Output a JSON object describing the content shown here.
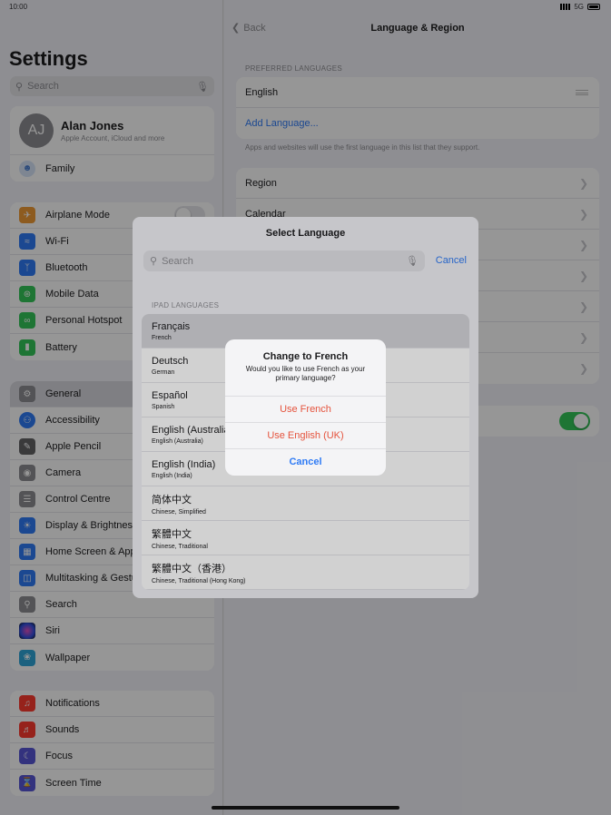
{
  "status": {
    "time": "10:00",
    "network": "5G"
  },
  "sidebar": {
    "title": "Settings",
    "search_placeholder": "Search",
    "profile": {
      "initials": "AJ",
      "name": "Alan Jones",
      "subtitle": "Apple Account, iCloud and more",
      "family": "Family"
    },
    "group1": [
      "Airplane Mode",
      "Wi-Fi",
      "Bluetooth",
      "Mobile Data",
      "Personal Hotspot",
      "Battery"
    ],
    "group2": [
      "General",
      "Accessibility",
      "Apple Pencil",
      "Camera",
      "Control Centre",
      "Display & Brightness",
      "Home Screen & App Library",
      "Multitasking & Gestures",
      "Search",
      "Siri",
      "Wallpaper"
    ],
    "group3": [
      "Notifications",
      "Sounds",
      "Focus",
      "Screen Time"
    ],
    "airplane_mode_on": false
  },
  "detail": {
    "back": "Back",
    "title": "Language & Region",
    "preferred_header": "PREFERRED LANGUAGES",
    "preferred_language": "English",
    "add_language": "Add Language...",
    "footnote": "Apps and websites will use the first language in this list that they support.",
    "region": "Region",
    "calendar": "Calendar",
    "toggle_on": true
  },
  "sheet": {
    "title": "Select Language",
    "search_placeholder": "Search",
    "cancel": "Cancel",
    "section": "IPAD LANGUAGES",
    "languages": [
      {
        "name": "Français",
        "sub": "French"
      },
      {
        "name": "Deutsch",
        "sub": "German"
      },
      {
        "name": "Español",
        "sub": "Spanish"
      },
      {
        "name": "English (Australia)",
        "sub": "English (Australia)"
      },
      {
        "name": "English (India)",
        "sub": "English (India)"
      },
      {
        "name": "简体中文",
        "sub": "Chinese, Simplified"
      },
      {
        "name": "繁體中文",
        "sub": "Chinese, Traditional"
      },
      {
        "name": "繁體中文（香港）",
        "sub": "Chinese, Traditional (Hong Kong)"
      }
    ]
  },
  "alert": {
    "title": "Change to French",
    "message": "Would you like to use French as your primary language?",
    "use_french": "Use French",
    "use_english": "Use English (UK)",
    "cancel": "Cancel"
  },
  "colors": {
    "accent": "#2f7bf5",
    "destructive": "#e5533d",
    "toggle_on": "#34c759"
  }
}
